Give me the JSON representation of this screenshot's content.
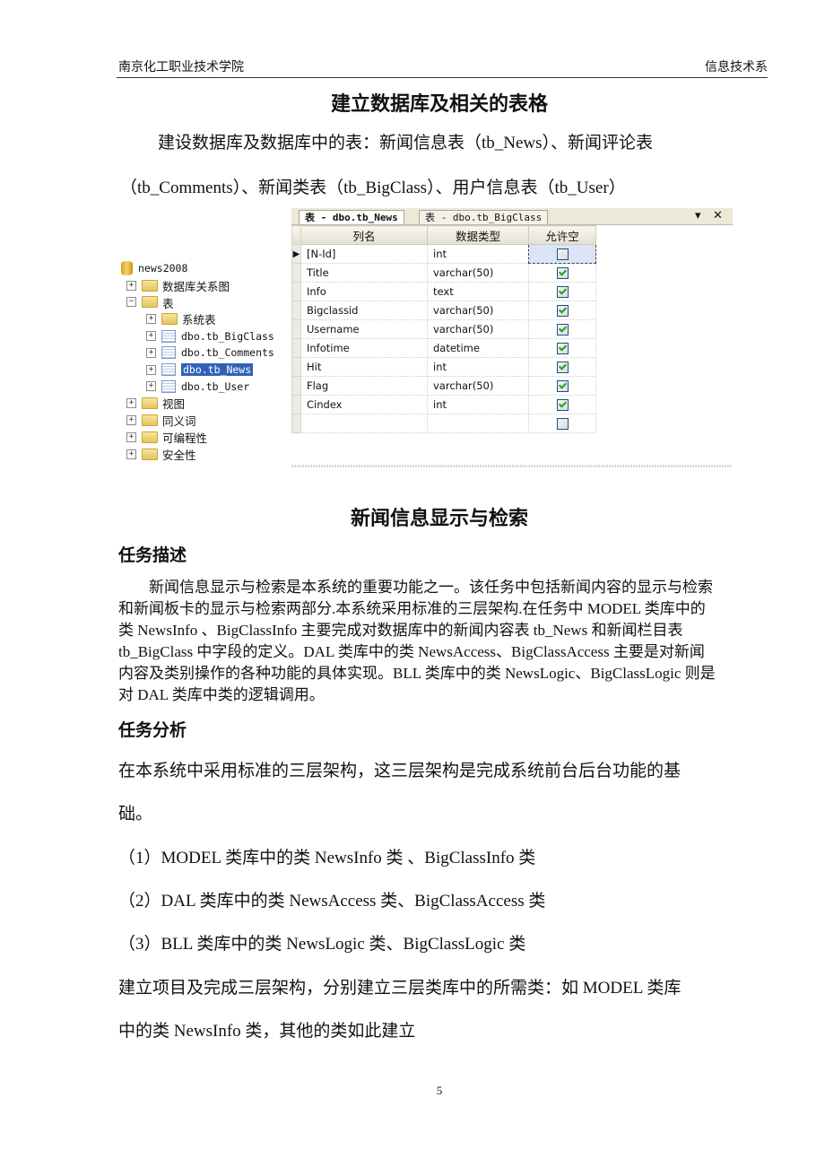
{
  "header": {
    "left": "南京化工职业技术学院",
    "right": "信息技术系"
  },
  "section1": {
    "title": "建立数据库及相关的表格",
    "intro_line1": "建设数据库及数据库中的表：新闻信息表（tb_News）、新闻评论表",
    "intro_line2": "（tb_Comments）、新闻类表（tb_BigClass）、用户信息表（tb_User）"
  },
  "screenshot": {
    "tree": {
      "database": "news2008",
      "items": [
        {
          "label": "数据库关系图",
          "type": "folder",
          "expander": "+"
        },
        {
          "label": "表",
          "type": "folder",
          "expander": "−"
        },
        {
          "label": "系统表",
          "type": "folder",
          "expander": "+"
        },
        {
          "label": "dbo.tb_BigClass",
          "type": "table",
          "expander": "+"
        },
        {
          "label": "dbo.tb_Comments",
          "type": "table",
          "expander": "+"
        },
        {
          "label": "dbo.tb_News",
          "type": "table",
          "expander": "+",
          "selected": true
        },
        {
          "label": "dbo.tb_User",
          "type": "table",
          "expander": "+"
        },
        {
          "label": "视图",
          "type": "folder",
          "expander": "+"
        },
        {
          "label": "同义词",
          "type": "folder",
          "expander": "+"
        },
        {
          "label": "可编程性",
          "type": "folder",
          "expander": "+"
        },
        {
          "label": "安全性",
          "type": "folder",
          "expander": "+"
        }
      ]
    },
    "tabs": [
      {
        "label": "表 - dbo.tb_News",
        "active": true
      },
      {
        "label": "表 - dbo.tb_BigClass",
        "active": false
      }
    ],
    "tab_controls": {
      "dropdown": "▾",
      "close": "✕"
    },
    "columns": [
      "列名",
      "数据类型",
      "允许空"
    ],
    "rows": [
      {
        "name": "[N-Id]",
        "type": "int",
        "nullable": false,
        "current": true
      },
      {
        "name": "Title",
        "type": "varchar(50)",
        "nullable": true
      },
      {
        "name": "Info",
        "type": "text",
        "nullable": true
      },
      {
        "name": "Bigclassid",
        "type": "varchar(50)",
        "nullable": true
      },
      {
        "name": "Username",
        "type": "varchar(50)",
        "nullable": true
      },
      {
        "name": "Infotime",
        "type": "datetime",
        "nullable": true
      },
      {
        "name": "Hit",
        "type": "int",
        "nullable": true
      },
      {
        "name": "Flag",
        "type": "varchar(50)",
        "nullable": true
      },
      {
        "name": "Cindex",
        "type": "int",
        "nullable": true
      },
      {
        "name": "",
        "type": "",
        "nullable": false
      }
    ],
    "row_indicator": "▶"
  },
  "section2": {
    "title": "新闻信息显示与检索",
    "desc_heading": "任务描述",
    "desc_lines": [
      "新闻信息显示与检索是本系统的重要功能之一。该任务中包括新闻内容的显示与检索",
      "和新闻板卡的显示与检索两部分.本系统采用标准的三层架构.在任务中 MODEL 类库中的",
      "类 NewsInfo 、BigClassInfo 主要完成对数据库中的新闻内容表 tb_News 和新闻栏目表",
      "tb_BigClass 中字段的定义。DAL 类库中的类 NewsAccess、BigClassAccess 主要是对新闻",
      "内容及类别操作的各种功能的具体实现。BLL 类库中的类 NewsLogic、BigClassLogic 则是",
      "对 DAL 类库中类的逻辑调用。"
    ],
    "analysis_heading": "任务分析",
    "analysis_line1": "在本系统中采用标准的三层架构，这三层架构是完成系统前台后台功能的基",
    "analysis_line2": "础。",
    "list": [
      "（1）MODEL 类库中的类 NewsInfo 类 、BigClassInfo 类",
      "（2）DAL 类库中的类 NewsAccess 类、BigClassAccess 类",
      "（3）BLL 类库中的类 NewsLogic 类、BigClassLogic 类"
    ],
    "closing_line1": "建立项目及完成三层架构，分别建立三层类库中的所需类：如 MODEL 类库",
    "closing_line2": "中的类 NewsInfo 类，其他的类如此建立"
  },
  "footer": {
    "page_number": "5"
  }
}
